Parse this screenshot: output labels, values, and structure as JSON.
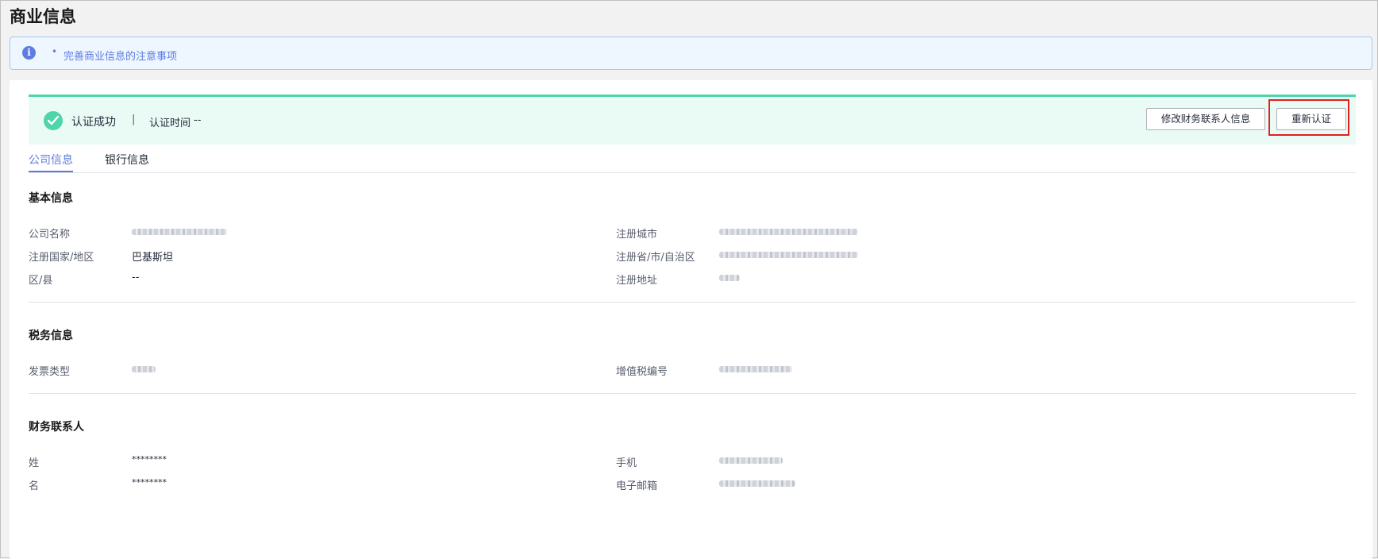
{
  "page": {
    "title": "商业信息"
  },
  "notice": {
    "bullet": "•",
    "link_text": "完善商业信息的注意事项"
  },
  "banner": {
    "status": "认证成功",
    "separator": "|",
    "time_label": "认证时间",
    "time_value": "--",
    "modify_button": "修改财务联系人信息",
    "reauth_button": "重新认证"
  },
  "tabs": [
    {
      "label": "公司信息",
      "active": true
    },
    {
      "label": "银行信息",
      "active": false
    }
  ],
  "basic": {
    "title": "基本信息",
    "company_name_label": "公司名称",
    "country_label": "注册国家/地区",
    "country_value": "巴基斯坦",
    "district_label": "区/县",
    "district_value": "--",
    "city_label": "注册城市",
    "province_label": "注册省/市/自治区",
    "address_label": "注册地址"
  },
  "tax": {
    "title": "税务信息",
    "invoice_type_label": "发票类型",
    "vat_label": "增值税编号"
  },
  "finance": {
    "title": "财务联系人",
    "last_name_label": "姓",
    "last_name_value": "********",
    "first_name_label": "名",
    "first_name_value": "********",
    "phone_label": "手机",
    "email_label": "电子邮箱"
  },
  "colors": {
    "accent": "#5e7ce0",
    "success": "#50d4ab",
    "highlight": "#e02020"
  }
}
